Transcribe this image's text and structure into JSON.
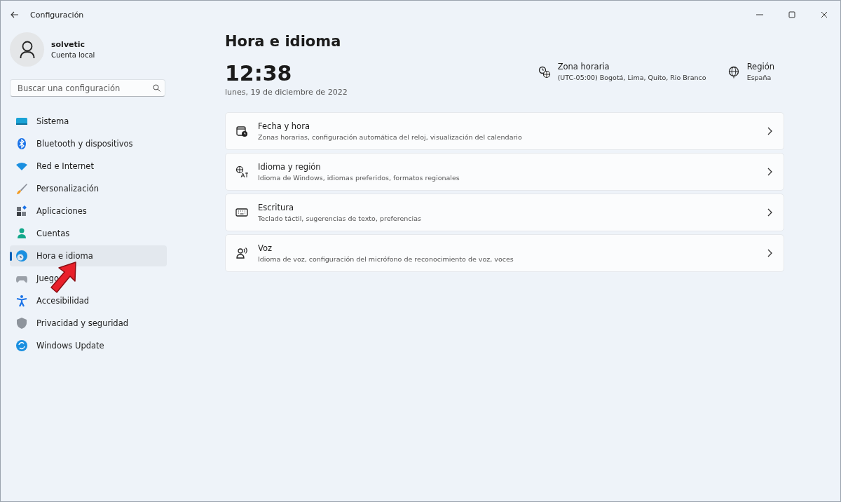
{
  "window": {
    "title": "Configuración"
  },
  "account": {
    "name": "solvetic",
    "type": "Cuenta local"
  },
  "search": {
    "placeholder": "Buscar una configuración"
  },
  "sidebar": {
    "items": [
      {
        "label": "Sistema",
        "selected": false
      },
      {
        "label": "Bluetooth y dispositivos",
        "selected": false
      },
      {
        "label": "Red e Internet",
        "selected": false
      },
      {
        "label": "Personalización",
        "selected": false
      },
      {
        "label": "Aplicaciones",
        "selected": false
      },
      {
        "label": "Cuentas",
        "selected": false
      },
      {
        "label": "Hora e idioma",
        "selected": true
      },
      {
        "label": "Juego",
        "selected": false
      },
      {
        "label": "Accesibilidad",
        "selected": false
      },
      {
        "label": "Privacidad y seguridad",
        "selected": false
      },
      {
        "label": "Windows Update",
        "selected": false
      }
    ]
  },
  "page": {
    "title": "Hora e idioma",
    "time": "12:38",
    "date": "lunes, 19 de diciembre de 2022",
    "info": [
      {
        "title": "Zona horaria",
        "value": "(UTC-05:00) Bogotá, Lima, Quito, Rio Branco"
      },
      {
        "title": "Región",
        "value": "España"
      }
    ],
    "cards": [
      {
        "title": "Fecha y hora",
        "description": "Zonas horarias, configuración automática del reloj, visualización del calendario"
      },
      {
        "title": "Idioma y región",
        "description": "Idioma de Windows, idiomas preferidos, formatos regionales"
      },
      {
        "title": "Escritura",
        "description": "Teclado táctil, sugerencias de texto, preferencias"
      },
      {
        "title": "Voz",
        "description": "Idioma de voz, configuración del micrófono de reconocimiento de voz, voces"
      }
    ]
  }
}
